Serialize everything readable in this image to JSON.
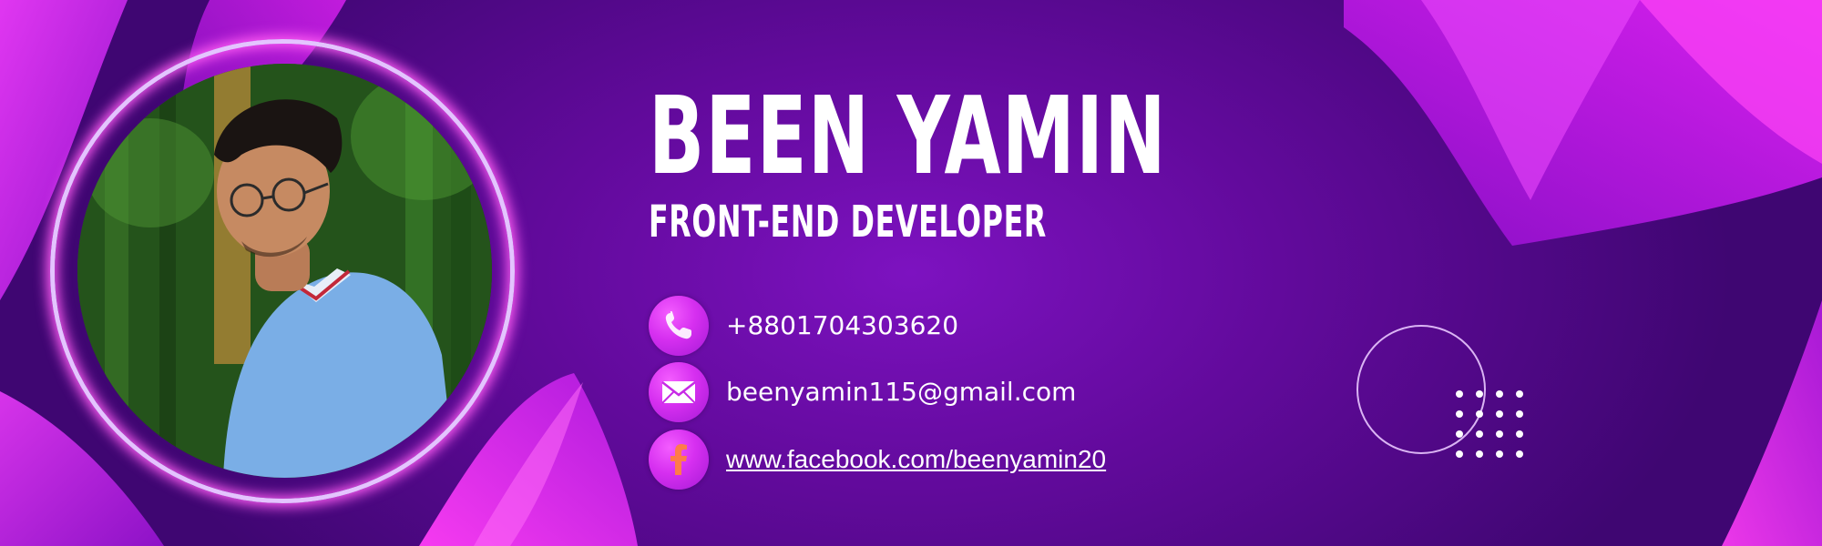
{
  "profile": {
    "name": "BEEN YAMIN",
    "title": "FRONT-END DEVELOPER"
  },
  "contacts": [
    {
      "icon": "phone-icon",
      "text": "+8801704303620"
    },
    {
      "icon": "mail-icon",
      "text": "beenyamin115@gmail.com"
    },
    {
      "icon": "facebook-icon",
      "text": "www.facebook.com/beenyamin20"
    }
  ],
  "colors": {
    "background": "#620a9c",
    "accent": "#e02cf0",
    "ring": "#e4c4ff",
    "text": "#ffffff"
  }
}
